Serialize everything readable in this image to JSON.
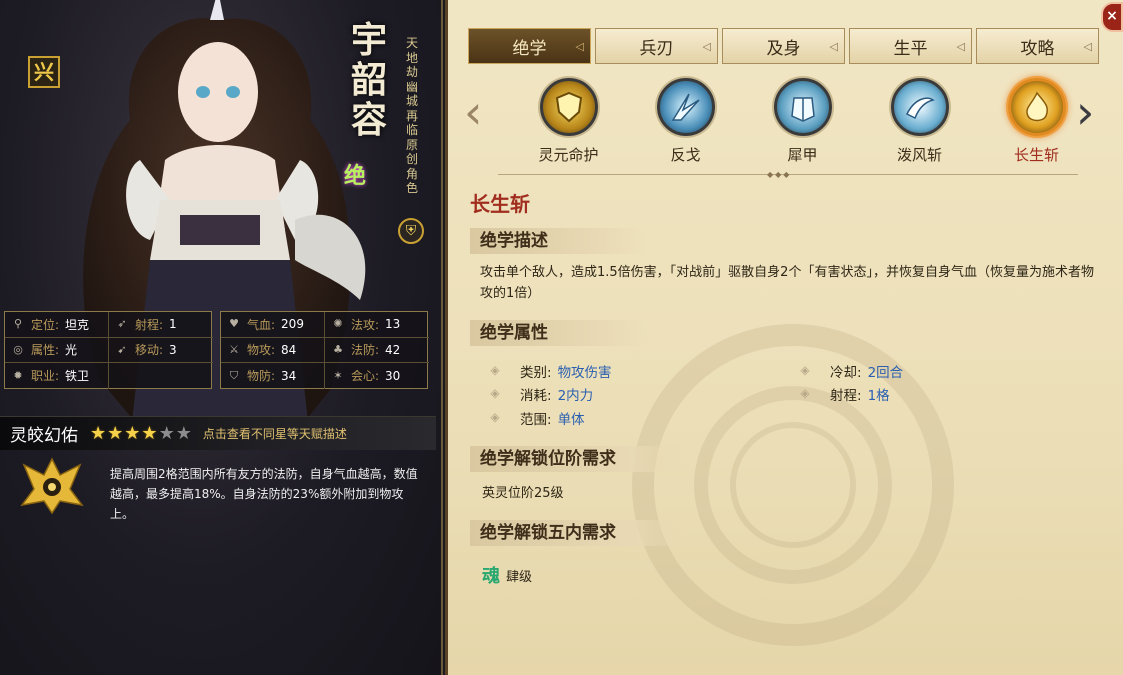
{
  "hero": {
    "name": "宇韶容",
    "subtitle": "天地劫幽城再临原创角色",
    "rank_badge": "兴",
    "rarity_badge": "绝",
    "class_badge_icon": "shield-icon"
  },
  "stats_left": [
    {
      "icon": "location-pin-icon",
      "label": "定位:",
      "value": "坦克"
    },
    {
      "icon": "range-arrow-icon",
      "label": "射程:",
      "value": "1"
    },
    {
      "icon": "swirl-element-icon",
      "label": "属性:",
      "value": "光"
    },
    {
      "icon": "boot-move-icon",
      "label": "移动:",
      "value": "3"
    },
    {
      "icon": "sun-class-icon",
      "label": "职业:",
      "value": "铁卫"
    }
  ],
  "stats_right": [
    {
      "icon": "heart-icon",
      "label": "气血:",
      "value": "209"
    },
    {
      "icon": "magic-attack-icon",
      "label": "法攻:",
      "value": "13"
    },
    {
      "icon": "sword-icon",
      "label": "物攻:",
      "value": "84"
    },
    {
      "icon": "magic-defense-icon",
      "label": "法防:",
      "value": "42"
    },
    {
      "icon": "armor-icon",
      "label": "物防:",
      "value": "34"
    },
    {
      "icon": "critical-icon",
      "label": "会心:",
      "value": "30"
    }
  ],
  "talent": {
    "title": "灵皎幻佑",
    "stars_filled": 4,
    "stars_total": 6,
    "hint": "点击查看不同星等天赋描述",
    "description": "提高周围2格范围内所有友方的法防，自身气血越高，数值越高，最多提高18%。自身法防的23%额外附加到物攻上。"
  },
  "tabs": [
    {
      "label": "绝学",
      "active": true
    },
    {
      "label": "兵刃",
      "active": false
    },
    {
      "label": "及身",
      "active": false
    },
    {
      "label": "生平",
      "active": false
    },
    {
      "label": "攻略",
      "active": false
    }
  ],
  "skills": [
    {
      "name": "灵元命护",
      "icon": "golden-shield-skill-icon",
      "selected": false
    },
    {
      "name": "反戈",
      "icon": "ice-spikes-skill-icon",
      "selected": false
    },
    {
      "name": "犀甲",
      "icon": "armor-skill-icon",
      "selected": false
    },
    {
      "name": "泼风斩",
      "icon": "wind-slash-skill-icon",
      "selected": false
    },
    {
      "name": "长生斩",
      "icon": "golden-flame-skill-icon",
      "selected": true
    }
  ],
  "detail": {
    "title": "长生斩",
    "desc_head": "绝学描述",
    "description": "攻击单个敌人，造成1.5倍伤害，「对战前」驱散自身2个「有害状态」，并恢复自身气血（恢复量为施术者物攻的1倍）",
    "attr_head": "绝学属性",
    "attributes": {
      "type_label": "类别:",
      "type_value": "物攻伤害",
      "cost_label": "消耗:",
      "cost_value": "2内力",
      "scope_label": "范围:",
      "scope_value": "单体",
      "cooldown_label": "冷却:",
      "cooldown_value": "2回合",
      "range_label": "射程:",
      "range_value": "1格"
    },
    "rank_req_head": "绝学解锁位阶需求",
    "rank_req": "英灵位阶25级",
    "inner_req_head": "绝学解锁五内需求",
    "inner_req_glyph": "魂",
    "inner_req": "肆级"
  },
  "close_label": "×",
  "colors": {
    "accent_red": "#a12d1e",
    "value_blue": "#2a5fb0",
    "gold": "#c9a032"
  }
}
